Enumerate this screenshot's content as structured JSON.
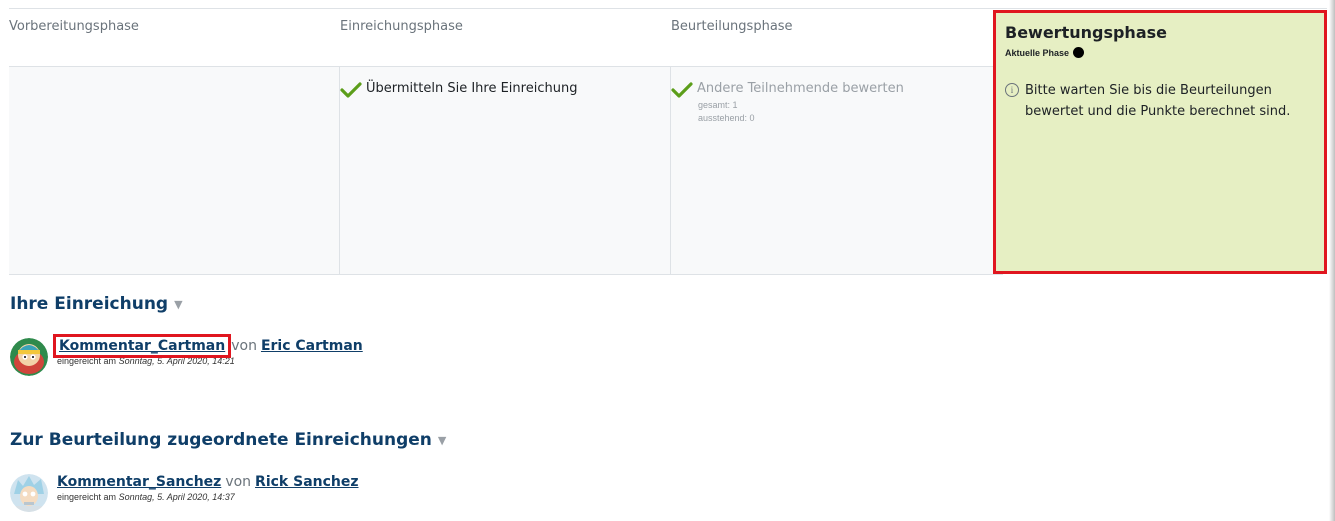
{
  "phases": {
    "setup": {
      "label": "Vorbereitungsphase"
    },
    "submission": {
      "label": "Einreichungsphase",
      "task": "Übermitteln Sie Ihre Einreichung"
    },
    "assessment": {
      "label": "Beurteilungsphase",
      "task": "Andere Teilnehmende bewerten",
      "total": "gesamt: 1",
      "pending": "ausstehend: 0"
    },
    "evaluation": {
      "label": "Bewertungsphase",
      "current_label": "Aktuelle Phase",
      "info": "Bitte warten Sie bis die Beurteilungen bewertet und die Punkte berechnet sind."
    }
  },
  "your_submission": {
    "heading": "Ihre Einreichung",
    "title": "Kommentar_Cartman",
    "by": "von",
    "author": "Eric Cartman",
    "date_prefix": "eingereicht am",
    "date": "Sonntag, 5. April 2020, 14:21"
  },
  "allocated": {
    "heading": "Zur Beurteilung zugeordnete Einreichungen",
    "title": "Kommentar_Sanchez",
    "by": "von",
    "author": "Rick Sanchez",
    "date_prefix": "eingereicht am",
    "date": "Sonntag, 5. April 2020, 14:37"
  },
  "colors": {
    "link": "#0f3e68",
    "highlight": "#e0161f",
    "current_phase_bg": "#e6efc3",
    "check": "#5c9e1a"
  },
  "icons": {
    "check": "check-icon",
    "info": "info-icon",
    "caret": "caret-down-icon"
  }
}
